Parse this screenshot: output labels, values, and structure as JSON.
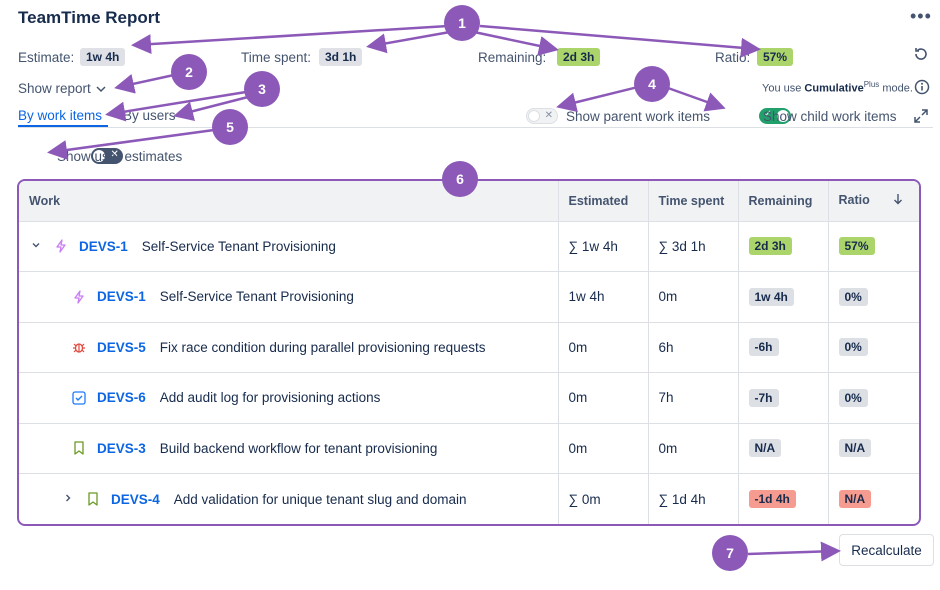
{
  "header": {
    "title": "TeamTime Report",
    "more_icon": "more-horizontal-icon"
  },
  "summary": {
    "estimate_label": "Estimate:",
    "estimate_value": "1w 4h",
    "time_spent_label": "Time spent:",
    "time_spent_value": "3d 1h",
    "remaining_label": "Remaining:",
    "remaining_value": "2d 3h",
    "ratio_label": "Ratio:",
    "ratio_value": "57%",
    "refresh_icon": "refresh-icon"
  },
  "show_report": {
    "label": "Show report",
    "icon": "chevron-down-icon"
  },
  "mode": {
    "prefix": "You use",
    "name": "Cumulative",
    "superscript": "Plus",
    "suffix": "mode.",
    "info_icon": "info-icon"
  },
  "tabs": [
    {
      "label": "By work items",
      "active": true
    },
    {
      "label": "By users",
      "active": false
    }
  ],
  "toggles": {
    "parent": {
      "label": "Show parent work items",
      "on": false
    },
    "child": {
      "label": "Show child work items",
      "on": true
    },
    "user_estimates": {
      "label": "Show user estimates",
      "on": false
    },
    "expand_icon": "expand-icon"
  },
  "table": {
    "headers": {
      "work": "Work",
      "estimated": "Estimated",
      "time_spent": "Time spent",
      "remaining": "Remaining",
      "ratio": "Ratio",
      "sort_icon": "arrow-down-icon"
    },
    "rows": [
      {
        "key": "DEVS-1",
        "summary": "Self-Service Tenant Provisioning",
        "type": "epic",
        "estimated": "∑ 1w 4h",
        "time_spent": "∑ 3d 1h",
        "remaining": "2d 3h",
        "ratio": "57%",
        "remaining_color": "#abd56a",
        "ratio_color": "#abd56a",
        "expander": "chevron-down-icon",
        "level": 0
      },
      {
        "key": "DEVS-1",
        "summary": "Self-Service Tenant Provisioning",
        "type": "epic",
        "estimated": "1w 4h",
        "time_spent": "0m",
        "remaining": "1w 4h",
        "ratio": "0%",
        "remaining_color": "#dcdfe4",
        "ratio_color": "#dcdfe4",
        "expander": "",
        "level": 1
      },
      {
        "key": "DEVS-5",
        "summary": "Fix race condition during parallel provisioning requests",
        "type": "bug",
        "estimated": "0m",
        "time_spent": "6h",
        "remaining": "-6h",
        "ratio": "0%",
        "remaining_color": "#dcdfe4",
        "ratio_color": "#dcdfe4",
        "expander": "",
        "level": 1
      },
      {
        "key": "DEVS-6",
        "summary": "Add audit log for provisioning actions",
        "type": "task",
        "estimated": "0m",
        "time_spent": "7h",
        "remaining": "-7h",
        "ratio": "0%",
        "remaining_color": "#dcdfe4",
        "ratio_color": "#dcdfe4",
        "expander": "",
        "level": 1
      },
      {
        "key": "DEVS-3",
        "summary": "Build backend workflow for tenant provisioning",
        "type": "story",
        "estimated": "0m",
        "time_spent": "0m",
        "remaining": "N/A",
        "ratio": "N/A",
        "remaining_color": "#dcdfe4",
        "ratio_color": "#dcdfe4",
        "expander": "",
        "level": 1
      },
      {
        "key": "DEVS-4",
        "summary": "Add validation for unique tenant slug and domain",
        "type": "story",
        "estimated": "∑ 0m",
        "time_spent": "∑ 1d 4h",
        "remaining": "-1d 4h",
        "ratio": "N/A",
        "remaining_color": "#f69b8f",
        "ratio_color": "#f69b8f",
        "expander": "chevron-right-icon",
        "level": 1
      }
    ]
  },
  "recalculate_label": "Recalculate",
  "annotations": [
    "1",
    "2",
    "3",
    "4",
    "5",
    "6",
    "7"
  ],
  "colors": {
    "accent": "#0c66e4",
    "annotation": "#8c59b8",
    "toggle_on": "#22a06b"
  }
}
